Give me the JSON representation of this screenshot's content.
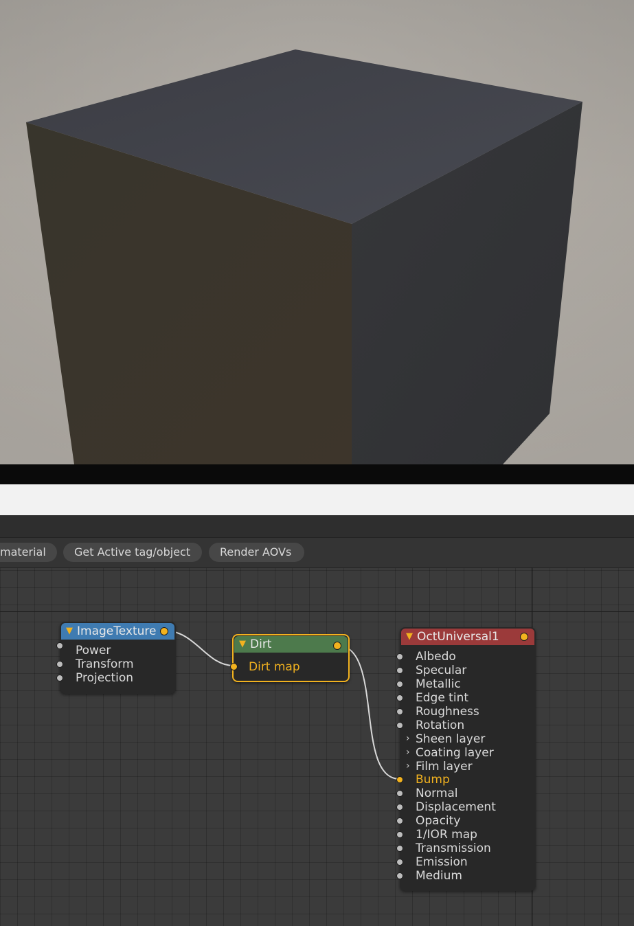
{
  "toolbar": {
    "buttons": [
      {
        "label": "material"
      },
      {
        "label": "Get Active tag/object"
      },
      {
        "label": "Render AOVs"
      }
    ]
  },
  "nodes": {
    "image_texture": {
      "title": "ImageTexture",
      "header_color": "#3f7bb1",
      "inputs": [
        "Power",
        "Transform",
        "Projection"
      ]
    },
    "dirt": {
      "title": "Dirt",
      "header_color": "#4d7a4c",
      "border_color": "#f2b21f",
      "inputs": [
        "Dirt map"
      ]
    },
    "oct_universal": {
      "title": "OctUniversal1",
      "header_color": "#9b3a3a",
      "inputs": [
        "Albedo",
        "Specular",
        "Metallic",
        "Edge tint",
        "Roughness",
        "Rotation",
        "Sheen layer",
        "Coating layer",
        "Film layer",
        "Bump",
        "Normal",
        "Displacement",
        "Opacity",
        "1/IOR map",
        "Transmission",
        "Emission",
        "Medium"
      ]
    }
  },
  "colors": {
    "port_active": "#f2b21f",
    "wire": "#d8d8d8"
  }
}
